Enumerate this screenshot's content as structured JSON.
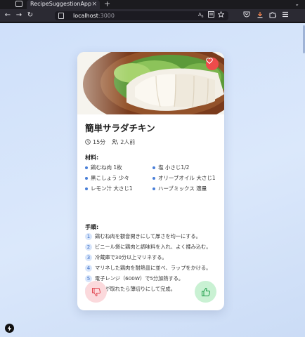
{
  "browser": {
    "tab_title": "RecipeSuggestionApp",
    "tab_close_glyph": "×",
    "new_tab_glyph": "+",
    "tab_list_glyph": "⌄",
    "back_glyph": "←",
    "forward_glyph": "→",
    "reload_glyph": "↻",
    "url_host": "localhost",
    "url_port": ":3000",
    "icons": [
      "back-icon",
      "forward-icon",
      "reload-icon",
      "page-icon",
      "translate-icon",
      "reader-view-icon",
      "bookmark-star-icon",
      "pocket-icon",
      "download-icon",
      "extensions-icon",
      "menu-icon"
    ]
  },
  "recipe": {
    "title": "簡単サラダチキン",
    "time": "15分",
    "servings": "2人前",
    "ingredients_label": "材料:",
    "ingredients": [
      "鶏むね肉 1枚",
      "塩 小さじ1/2",
      "黒こしょう 少々",
      "オリーブオイル 大さじ1",
      "レモン汁 大さじ1",
      "ハーブミックス 適量"
    ],
    "steps_label": "手順:",
    "steps": [
      {
        "num": "1",
        "text": "鶏むね肉を観音開きにして厚さを均一にする。"
      },
      {
        "num": "2",
        "text": "ビニール袋に鶏肉と調味料を入れ、よく揉み込む。"
      },
      {
        "num": "3",
        "text": "冷蔵庫で30分以上マリネする。"
      },
      {
        "num": "4",
        "text": "マリネした鶏肉を耐熱皿に並べ、ラップをかける。"
      },
      {
        "num": "5",
        "text": "電子レンジ（600W）で5分加熱する。"
      },
      {
        "num": "6",
        "text": "粗熱が取れたら薄切りにして完成。"
      }
    ]
  },
  "colors": {
    "accent": "#4a7fd8",
    "favorite": "#ee4b4b",
    "dislike_bg": "#fbd9dc",
    "dislike_fg": "#e0454f",
    "like_bg": "#c9f1d3",
    "like_fg": "#1f9d4a"
  }
}
